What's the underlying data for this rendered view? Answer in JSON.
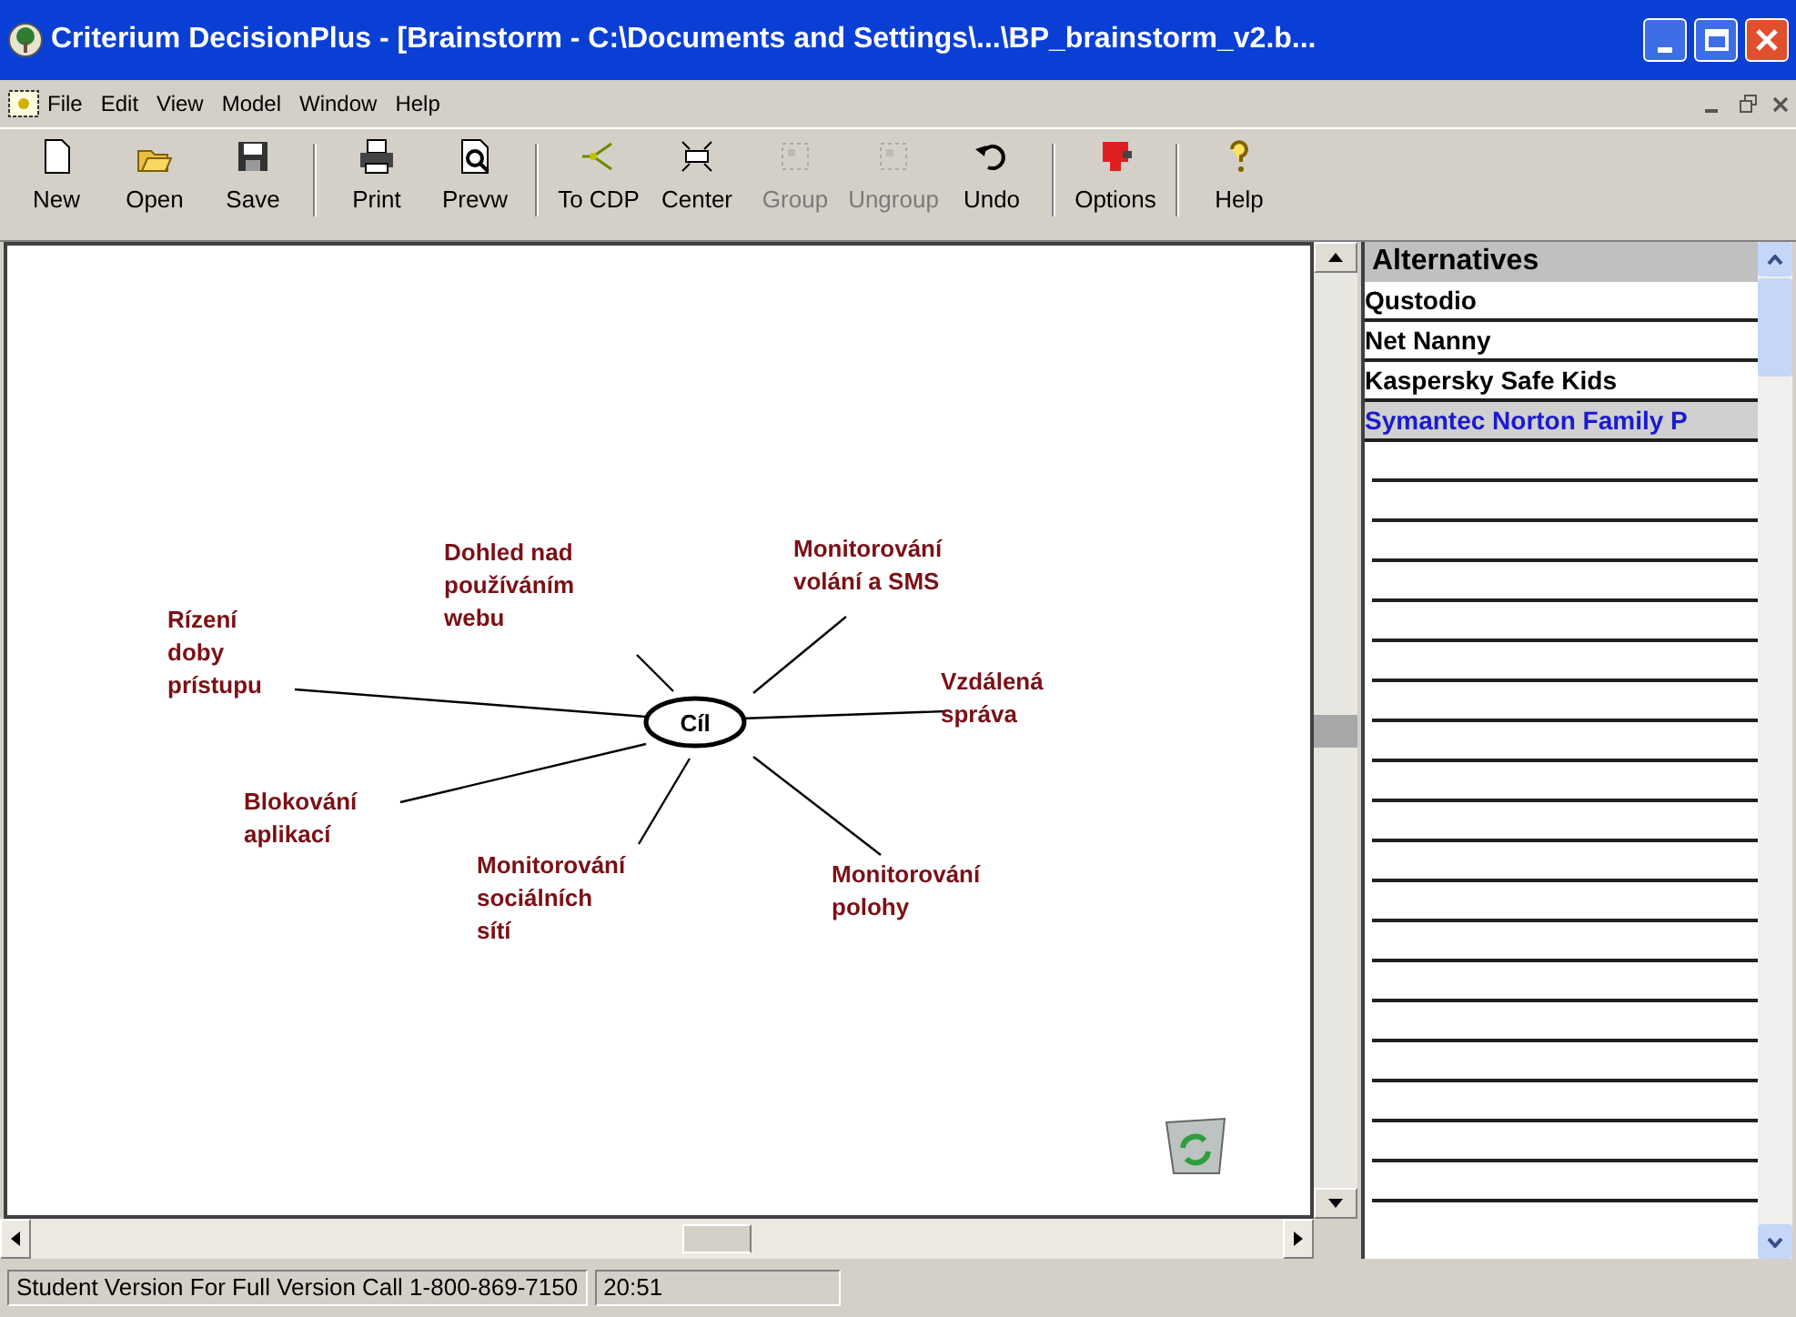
{
  "window": {
    "title": "Criterium DecisionPlus - [Brainstorm - C:\\Documents and Settings\\...\\BP_brainstorm_v2.b..."
  },
  "menu": [
    "File",
    "Edit",
    "View",
    "Model",
    "Window",
    "Help"
  ],
  "toolbar": [
    {
      "label": "New",
      "disabled": false
    },
    {
      "label": "Open",
      "disabled": false
    },
    {
      "label": "Save",
      "disabled": false
    },
    {
      "label": "Print",
      "disabled": false
    },
    {
      "label": "Prevw",
      "disabled": false
    },
    {
      "label": "To CDP",
      "disabled": false
    },
    {
      "label": "Center",
      "disabled": false
    },
    {
      "label": "Group",
      "disabled": true
    },
    {
      "label": "Ungroup",
      "disabled": true
    },
    {
      "label": "Undo",
      "disabled": false
    },
    {
      "label": "Options",
      "disabled": false
    },
    {
      "label": "Help",
      "disabled": false
    }
  ],
  "brainstorm": {
    "center": "Cíl",
    "ideas": [
      {
        "label": "Dohled nad\npoužíváním\nwebu"
      },
      {
        "label": "Monitorování\nvolání a SMS"
      },
      {
        "label": "Rízení\ndoby\nprístupu"
      },
      {
        "label": "Vzdálená\nspráva"
      },
      {
        "label": "Blokování\naplikací"
      },
      {
        "label": "Monitorování\nsociálních\nsítí"
      },
      {
        "label": "Monitorování\npolohy"
      }
    ]
  },
  "alternatives": {
    "title": "Alternatives",
    "items": [
      {
        "name": "Qustodio",
        "selected": false
      },
      {
        "name": "Net Nanny",
        "selected": false
      },
      {
        "name": "Kaspersky Safe Kids",
        "selected": false
      },
      {
        "name": "Symantec Norton Family P",
        "selected": true
      }
    ]
  },
  "status_bar": [
    "Student Version For Full Version Call 1-800-869-7150",
    "20:51"
  ]
}
